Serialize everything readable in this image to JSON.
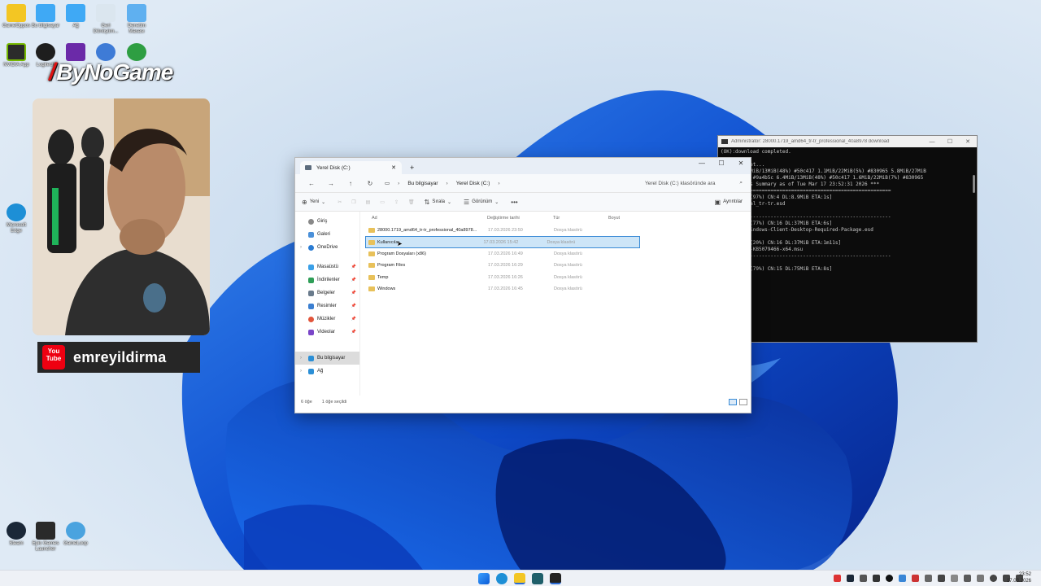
{
  "brand": {
    "text": "ByNoGame"
  },
  "youtube": {
    "logo_line1": "You",
    "logo_line2": "Tube",
    "channel": "emreyildirma"
  },
  "desktop_icons": [
    {
      "label": "GameOppos",
      "color": "#f3c623",
      "icon": "folder-icon"
    },
    {
      "label": "Bu bilgisayar",
      "color": "#3fa9f5",
      "icon": "monitor-icon"
    },
    {
      "label": "Ağ",
      "color": "#3fa9f5",
      "icon": "network-icon"
    },
    {
      "label": "Geri Dönüşüm...",
      "color": "#dbe6ef",
      "icon": "recycle-bin-icon"
    },
    {
      "label": "Denetim Masası",
      "color": "#5fb0f0",
      "icon": "control-panel-icon"
    },
    {
      "label": "NVIDIA App",
      "color": "#2b2b2b",
      "icon": "nvidia-icon"
    },
    {
      "label": "Logitech",
      "color": "#1e1e1e",
      "icon": "logitech-icon"
    },
    {
      "label": "",
      "color": "#6b2aa8",
      "icon": "app-icon"
    },
    {
      "label": "",
      "color": "#3e7bd6",
      "icon": "app-icon"
    },
    {
      "label": "",
      "color": "#2e9e42",
      "icon": "app-icon"
    },
    {
      "label": "Microsoft Edge",
      "color": "#1d8fd6",
      "icon": "edge-icon"
    },
    {
      "label": "Steam",
      "color": "#1b2838",
      "icon": "steam-icon"
    },
    {
      "label": "Epic Games Launcher",
      "color": "#2a2a2a",
      "icon": "epic-icon"
    },
    {
      "label": "GameLoop",
      "color": "#4aa3df",
      "icon": "gameloop-icon"
    }
  ],
  "terminal": {
    "title": "Administrator: 28000.1719_amd64_tr-tr_professional_40a8978 download",
    "lines": [
      "(OK):download completed.",
      "",
      " the UUP set...",
      "9a4b5c 6.4MiB/13MiB(48%) #50c417 1.1MiB/22MiB(5%) #830965 5.8MiB/27MiB",
      "5 DL:29MiB #9a4b5c 6.4MiB/13MiB(48%) #50c417 1.6MiB/22MiB(7%) #830965",
      "nd Progress Summary as of Tue Mar 17 23:52:31 2026 ***",
      "==========================================================",
      "MiB/462MiB(97%) CN:4 DL:8.9MiB ETA:1s]",
      "professional_tr-tr.esd",
      "",
      "----------------------------------------------------------",
      "MiB/1.0GiB(77%) CN:16 DL:37MiB ETA:6s]",
      "icrosoft-Windows-Client-Desktop-Required-Package.esd",
      "",
      "MiB/2.9GiB(20%) CN:16 DL:37MiB ETA:1m11s]",
      "indows11.0-KB5079466-x64.msu",
      "----------------------------------------------------------",
      "",
      "MiB/2.9GiB(79%) CN:15 DL:75MiB ETA:8s]"
    ]
  },
  "explorer": {
    "tab_title": "Yerel Disk (C:)",
    "breadcrumbs": [
      "Bu bilgisayar",
      "Yerel Disk (C:)"
    ],
    "search_placeholder": "Yerel Disk (C:) klasöründe ara",
    "toolbar": {
      "new": "Yeni",
      "sort": "Sırala",
      "view": "Görünüm",
      "details": "Ayrıntılar"
    },
    "nav": {
      "home": "Giriş",
      "gallery": "Galeri",
      "onedrive": "OneDrive",
      "desktop": "Masaüstü",
      "downloads": "İndirilenler",
      "documents": "Belgeler",
      "pictures": "Resimler",
      "music": "Müzikler",
      "videos": "Videolar",
      "thispc": "Bu bilgisayar",
      "network": "Ağ"
    },
    "columns": [
      "Ad",
      "Değiştirme tarihi",
      "Tür",
      "Boyut"
    ],
    "rows": [
      {
        "name": "28000.1719_amd64_tr-tr_professional_40a8978...",
        "date": "17.03.2026 23:50",
        "type": "Dosya klasörü",
        "size": ""
      },
      {
        "name": "Kullanıcılar",
        "date": "17.03.2026 15:42",
        "type": "Dosya klasörü",
        "size": ""
      },
      {
        "name": "Program Dosyaları (x86)",
        "date": "17.03.2026 16:49",
        "type": "Dosya klasörü",
        "size": ""
      },
      {
        "name": "Program Files",
        "date": "17.03.2026 16:29",
        "type": "Dosya klasörü",
        "size": ""
      },
      {
        "name": "Temp",
        "date": "17.03.2026 16:26",
        "type": "Dosya klasörü",
        "size": ""
      },
      {
        "name": "Windows",
        "date": "17.03.2026 16:45",
        "type": "Dosya klasörü",
        "size": ""
      }
    ],
    "status": {
      "count": "6 öğe",
      "selected": "1 öğe seçildi"
    }
  },
  "taskbar": {
    "time": "23:52",
    "date": "17.03.2026"
  }
}
